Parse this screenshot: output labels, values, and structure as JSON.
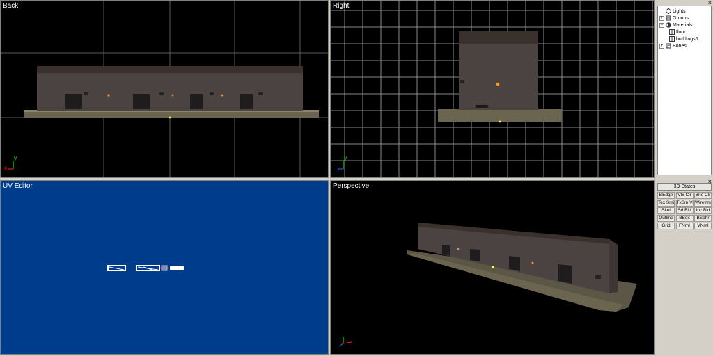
{
  "viewports": {
    "back": {
      "title": "Back"
    },
    "right": {
      "title": "Right"
    },
    "uv": {
      "title": "UV Editor"
    },
    "perspective": {
      "title": "Perspective"
    }
  },
  "axes": {
    "y": "y",
    "x": "x"
  },
  "scene_panel": {
    "close": "×",
    "tree": [
      {
        "label": "Lights",
        "icon": "light-icon",
        "expander": "",
        "level": 0
      },
      {
        "label": "Groups",
        "icon": "group-icon",
        "expander": "+",
        "level": 0
      },
      {
        "label": "Materials",
        "icon": "material-icon",
        "expander": "−",
        "level": 0
      },
      {
        "label": "floor",
        "icon": "texture-icon",
        "expander": "",
        "level": 1
      },
      {
        "label": "buildings5",
        "icon": "texture-icon",
        "expander": "",
        "level": 1
      },
      {
        "label": "Bones",
        "icon": "bone-icon",
        "expander": "+",
        "level": 0
      }
    ]
  },
  "states_panel": {
    "close": "×",
    "title": "3D States",
    "buttons": [
      "BEdge",
      "Vtx Clr",
      "Bne Clr",
      "Tex Smi",
      "TxSmIVr",
      "Wirefrme",
      "Skel",
      "Sd Bld",
      "Inc Bld",
      "Outline",
      "BBox",
      "BSphr",
      "Grid",
      "FNmI",
      "VNmI"
    ]
  },
  "colors": {
    "viewport_bg": "#000000",
    "uv_bg": "#003c8c",
    "panel_bg": "#d4d0c8",
    "axis_x": "#ff2020",
    "axis_y": "#20ff20",
    "axis_z": "#4060ff",
    "building_wall": "#4a4240",
    "building_roof": "#3a2f2a",
    "base": "#6f6852"
  }
}
